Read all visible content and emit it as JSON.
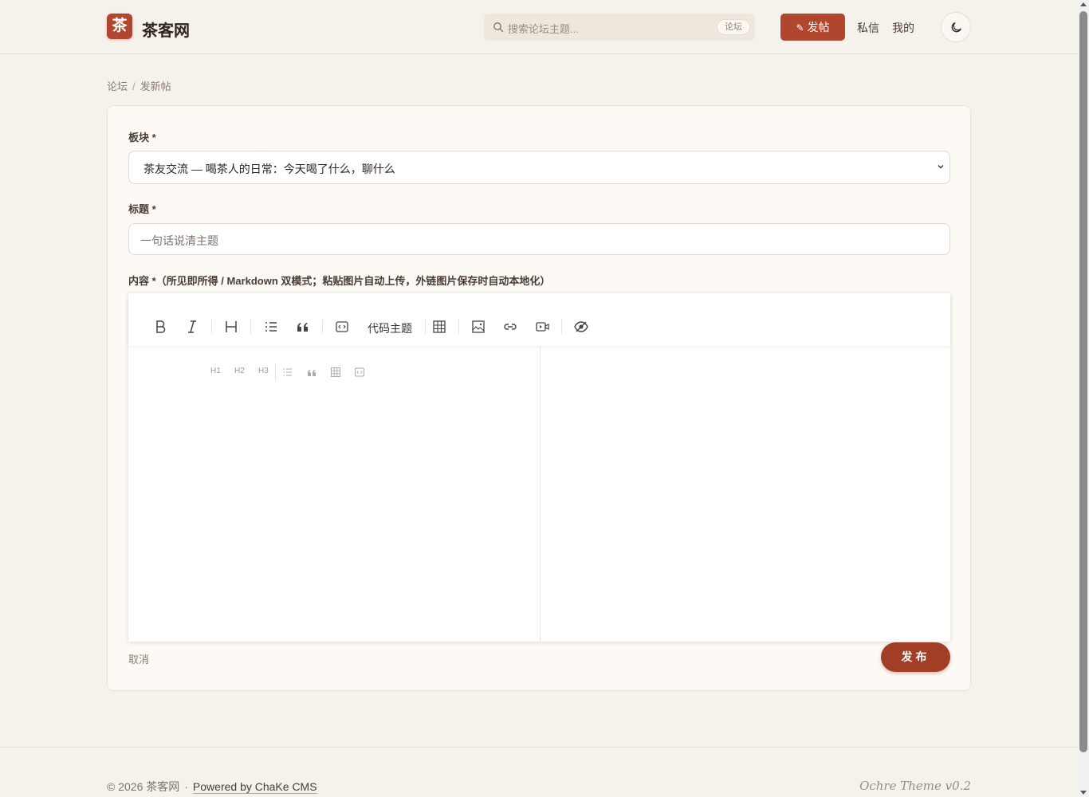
{
  "header": {
    "logo_char": "茶",
    "site_name": "茶客网",
    "search_placeholder": "搜索论坛主题...",
    "search_scope": "论坛",
    "post_button": "发帖",
    "nav_messages": "私信",
    "nav_mine": "我的",
    "theme_toggle_icon": "moon-icon"
  },
  "breadcrumb": {
    "items": [
      "论坛",
      "发新帖"
    ],
    "separator": "/"
  },
  "form": {
    "board_label": "板块 *",
    "board_value": "茶友交流 — 喝茶人的日常：今天喝了什么，聊什么",
    "title_label": "标题 *",
    "title_placeholder": "一句话说清主题",
    "content_label": "内容 *（所见即所得 / Markdown 双模式；粘贴图片自动上传，外链图片保存时自动本地化）",
    "toolbar": {
      "code_theme": "代码主题",
      "icons": [
        "bold-icon",
        "italic-icon",
        "heading-icon",
        "list-icon",
        "quote-icon",
        "code-icon",
        "table-icon",
        "image-icon",
        "link-icon",
        "video-icon",
        "preview-icon"
      ]
    },
    "mini_toolbar": {
      "h1": "H1",
      "h2": "H2",
      "h3": "H3"
    },
    "cancel": "取消",
    "publish": "发布"
  },
  "footer": {
    "copyright": "© 2026 茶客网",
    "separator": "·",
    "powered": "Powered by ChaKe CMS",
    "theme": "Ochre Theme v0.2"
  },
  "colors": {
    "accent": "#b0462d",
    "background": "#f5f1eb",
    "card": "#fdfaf6"
  }
}
